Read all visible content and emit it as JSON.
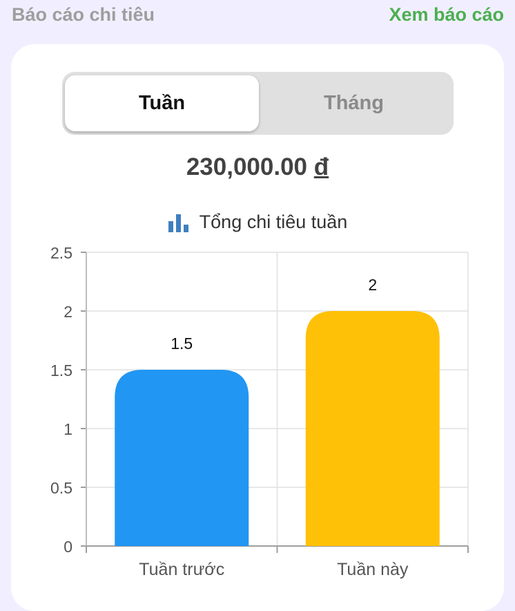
{
  "header": {
    "title": "Báo cáo chi tiêu",
    "link_label": "Xem báo cáo"
  },
  "period_toggle": {
    "options": [
      "Tuần",
      "Tháng"
    ],
    "selected": "Tuần"
  },
  "summary": {
    "amount": "230,000.00",
    "currency": "đ"
  },
  "chart_header": {
    "icon": "bar-chart-icon",
    "label": "Tổng chi tiêu tuần"
  },
  "colors": {
    "header_link": "#4caf50",
    "bar_last_week": "#2196f3",
    "bar_this_week": "#ffc107",
    "chart_icon": "#3f7fbf"
  },
  "chart_data": {
    "type": "bar",
    "categories": [
      "Tuần trước",
      "Tuần này"
    ],
    "values": [
      1.5,
      2
    ],
    "value_labels": [
      "1.5",
      "2"
    ],
    "ylim": [
      0,
      2.5
    ],
    "yticks": [
      "0",
      "0.5",
      "1",
      "1.5",
      "2",
      "2.5"
    ],
    "grid": true
  }
}
